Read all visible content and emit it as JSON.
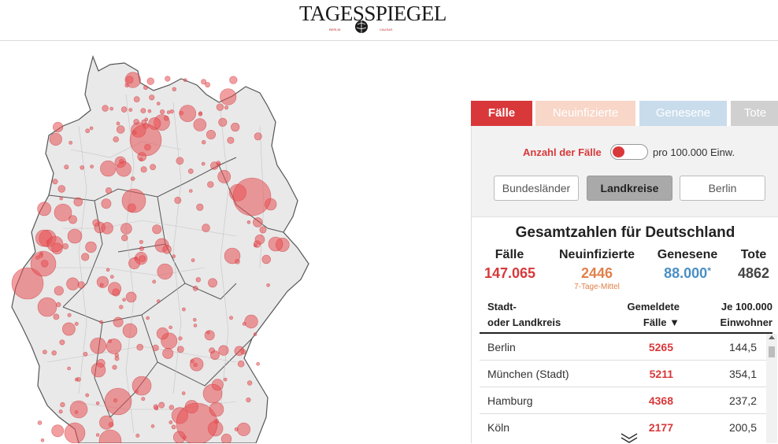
{
  "header": {
    "logo_text": "TAGESSPIEGEL",
    "logo_sub_left": "BERLIN",
    "logo_sub_right": "CAUSAS"
  },
  "tabs": [
    {
      "label": "Fälle",
      "active": true
    },
    {
      "label": "Neuinfizierte",
      "active": false
    },
    {
      "label": "Genesene",
      "active": false
    },
    {
      "label": "Tote",
      "active": false
    }
  ],
  "toggle": {
    "left_label": "Anzahl der Fälle",
    "right_label": "pro 100.000 Einw.",
    "state": "left"
  },
  "segments": [
    {
      "label": "Bundesländer",
      "active": false
    },
    {
      "label": "Landkreise",
      "active": true
    },
    {
      "label": "Berlin",
      "active": false
    }
  ],
  "summary": {
    "title": "Gesamtzahlen für Deutschland",
    "cases_label": "Fälle",
    "cases_value": "147.065",
    "new_label": "Neuinfizierte",
    "new_value": "2446",
    "new_note": "7-Tage-Mittel",
    "recovered_label": "Genesene",
    "recovered_value": "88.000",
    "recovered_mark": "*",
    "deaths_label": "Tote",
    "deaths_value": "4862"
  },
  "table": {
    "col1_line1": "Stadt-",
    "col1_line2": "oder Landkreis",
    "col2_line1": "Gemeldete",
    "col2_line2": "Fälle ▼",
    "col3_line1": "Je 100.000",
    "col3_line2": "Einwohner",
    "rows": [
      {
        "name": "Berlin",
        "cases": "5265",
        "per100k": "144,5"
      },
      {
        "name": "München (Stadt)",
        "cases": "5211",
        "per100k": "354,1"
      },
      {
        "name": "Hamburg",
        "cases": "4368",
        "per100k": "237,2"
      },
      {
        "name": "Köln",
        "cases": "2177",
        "per100k": "200,5"
      }
    ]
  },
  "colors": {
    "accent": "#d9383a",
    "new": "#e0804a",
    "recovered": "#4a8fc4",
    "map_fill": "#e9e9e9",
    "bubble": "#e8565a"
  },
  "icons": {
    "more": "double-chevron-down-icon",
    "logo": "globe-icon"
  }
}
